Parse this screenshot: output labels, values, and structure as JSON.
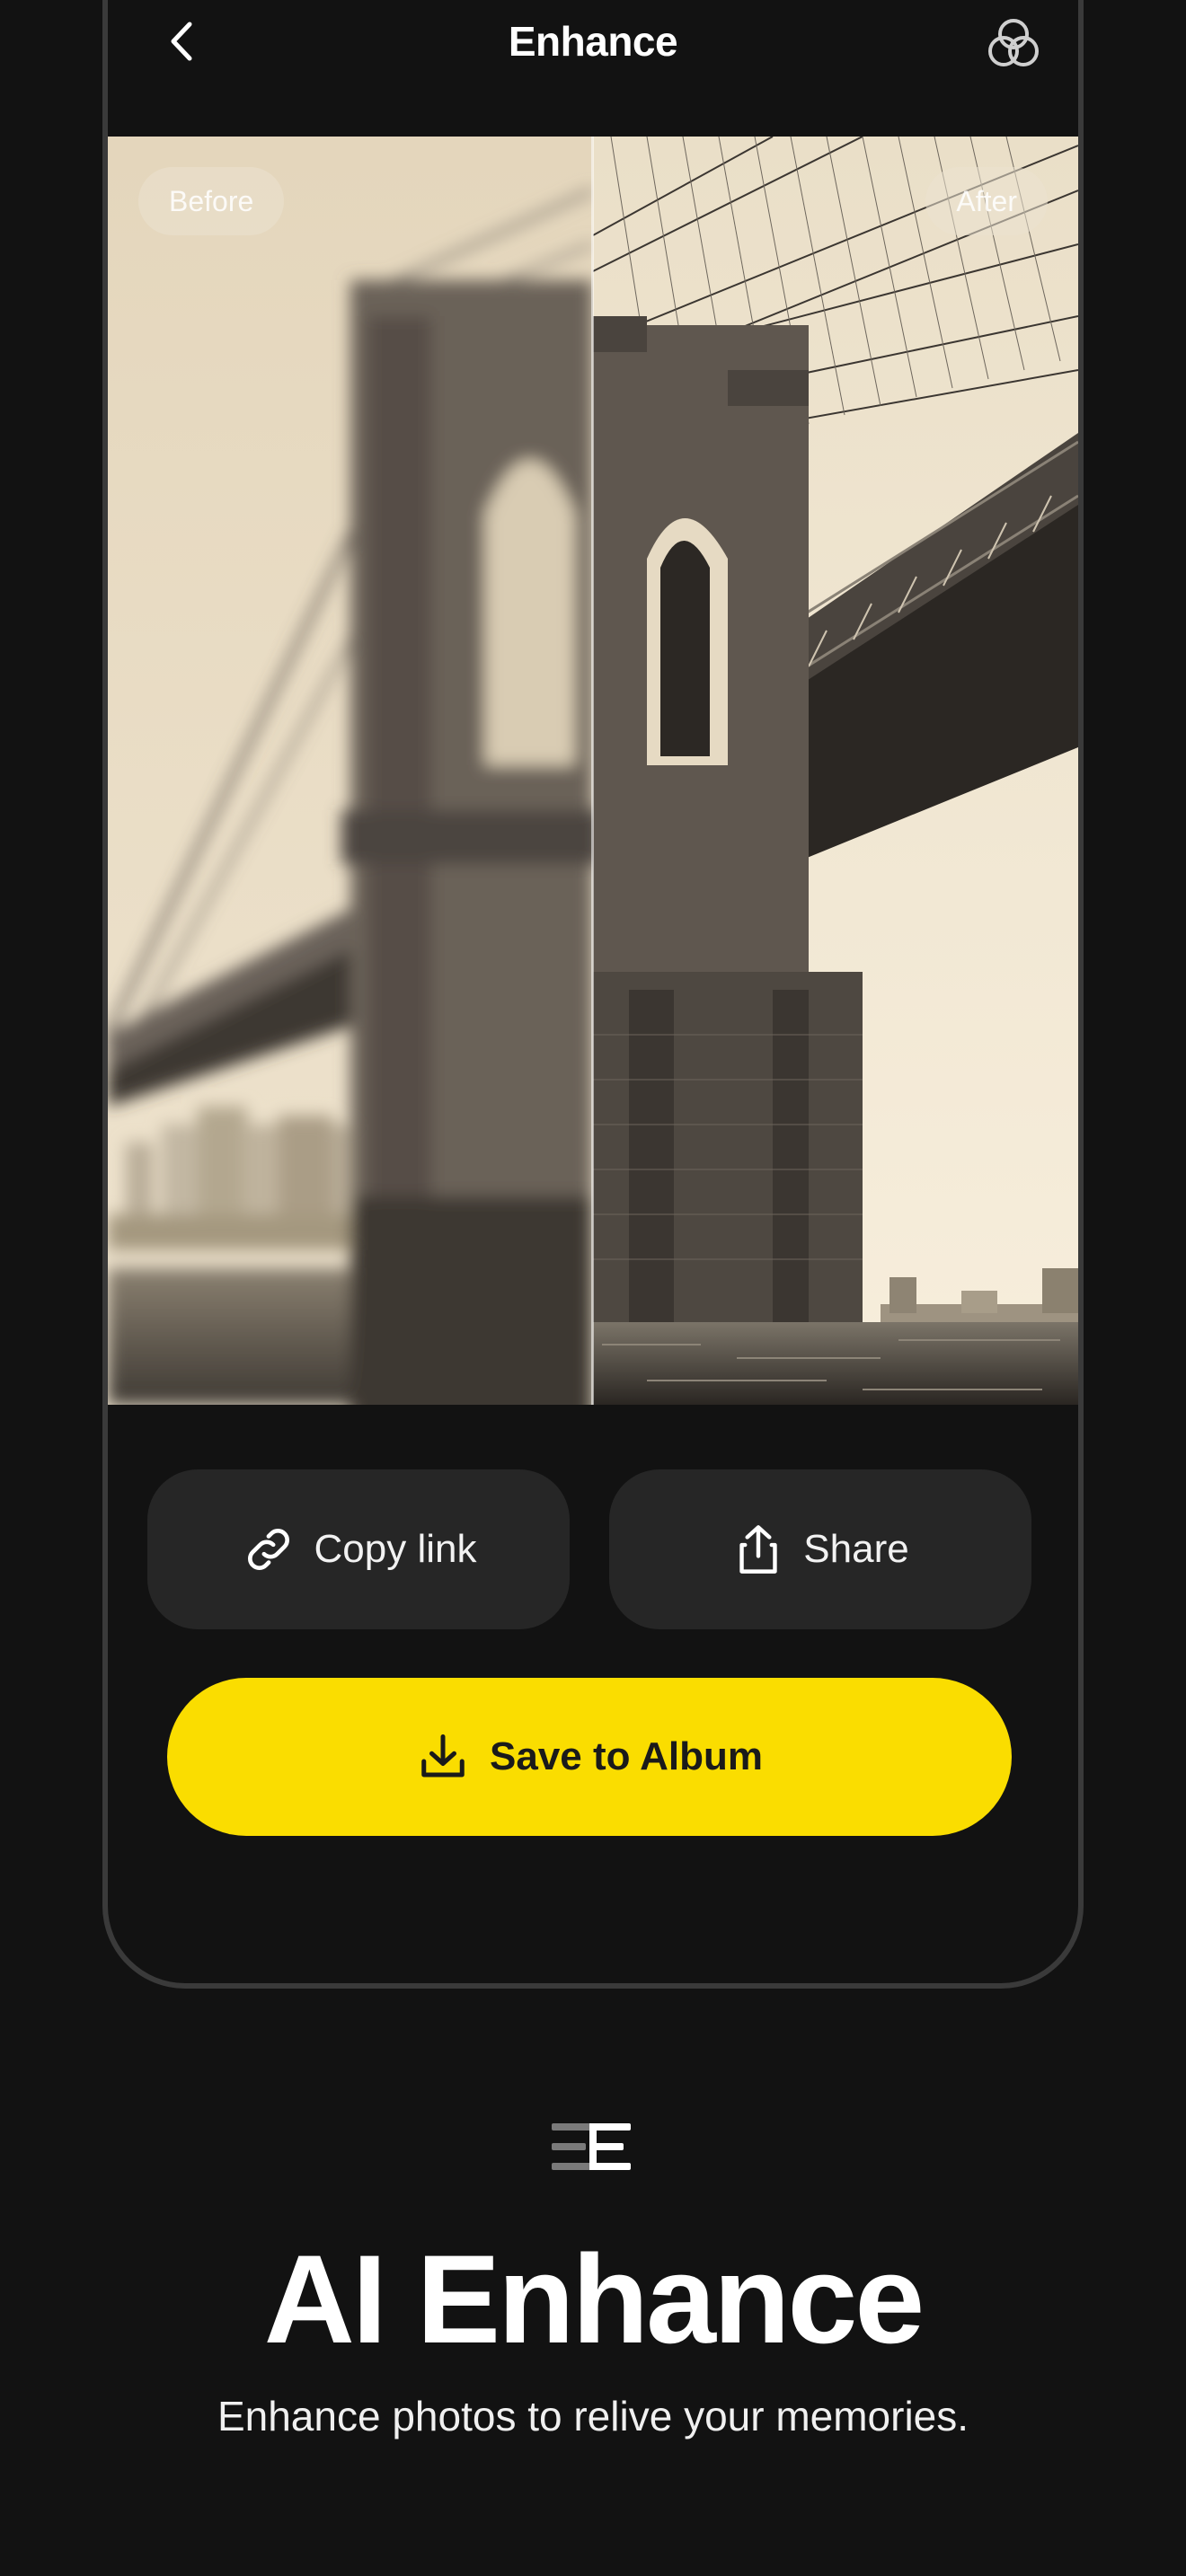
{
  "header": {
    "title": "Enhance",
    "back_icon": "chevron-left-icon",
    "action_icon": "overlapping-circles-icon"
  },
  "compare": {
    "before_label": "Before",
    "after_label": "After",
    "divider_position": 0.5
  },
  "actions": {
    "copy_link_label": "Copy link",
    "copy_link_icon": "link-icon",
    "share_label": "Share",
    "share_icon": "share-icon",
    "save_label": "Save to Album",
    "save_icon": "download-icon"
  },
  "feature": {
    "icon": "enhance-lines-icon",
    "title": "AI Enhance",
    "subtitle": "Enhance photos to relive your memories."
  },
  "colors": {
    "background": "#121212",
    "button_dark": "#262626",
    "accent_yellow": "#fadd00",
    "sepia_light": "#efe3cc"
  }
}
